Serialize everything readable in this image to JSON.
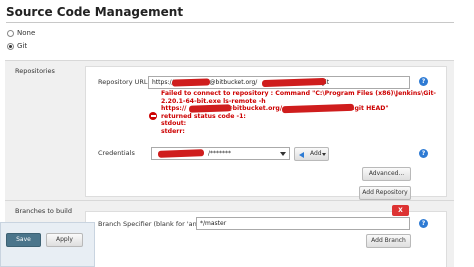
{
  "section_title": "Source Code Management",
  "scm_options": [
    {
      "label": "None",
      "selected": false
    },
    {
      "label": "Git",
      "selected": true
    }
  ],
  "repositories": {
    "label": "Repositories",
    "url_label": "Repository URL",
    "url_prefix": "https://",
    "url_mid": "@bitbucket.org/",
    "url_suffix": ".git",
    "error_lines": [
      "Failed to connect to repository : Command \"C:\\Program Files (x86)\\Jenkins\\Git-",
      "2.20.1-64-bit.exe ls-remote -h",
      "https://",
      "returned status code -1:",
      "stdout:",
      "stderr:"
    ],
    "error_url_mid": "@bitbucket.org/",
    "error_url_end": ".git HEAD\"",
    "credentials_label": "Credentials",
    "credentials_value": "/*******",
    "add_label": "Add",
    "advanced_label": "Advanced...",
    "add_repository_label": "Add Repository"
  },
  "branches": {
    "label": "Branches to build",
    "delete_label": "X",
    "specifier_label": "Branch Specifier (blank for 'any')",
    "specifier_value": "*/master",
    "add_branch_label": "Add Branch"
  },
  "footer": {
    "save_label": "Save",
    "apply_label": "Apply"
  },
  "colors": {
    "error": "#cc0000",
    "help": "#2e7bd4",
    "save_button": "#4b758b",
    "delete_button": "#dd3333"
  },
  "icons": [
    "help-icon",
    "error-icon",
    "add-arrow-icon",
    "dropdown-arrow-icon"
  ]
}
